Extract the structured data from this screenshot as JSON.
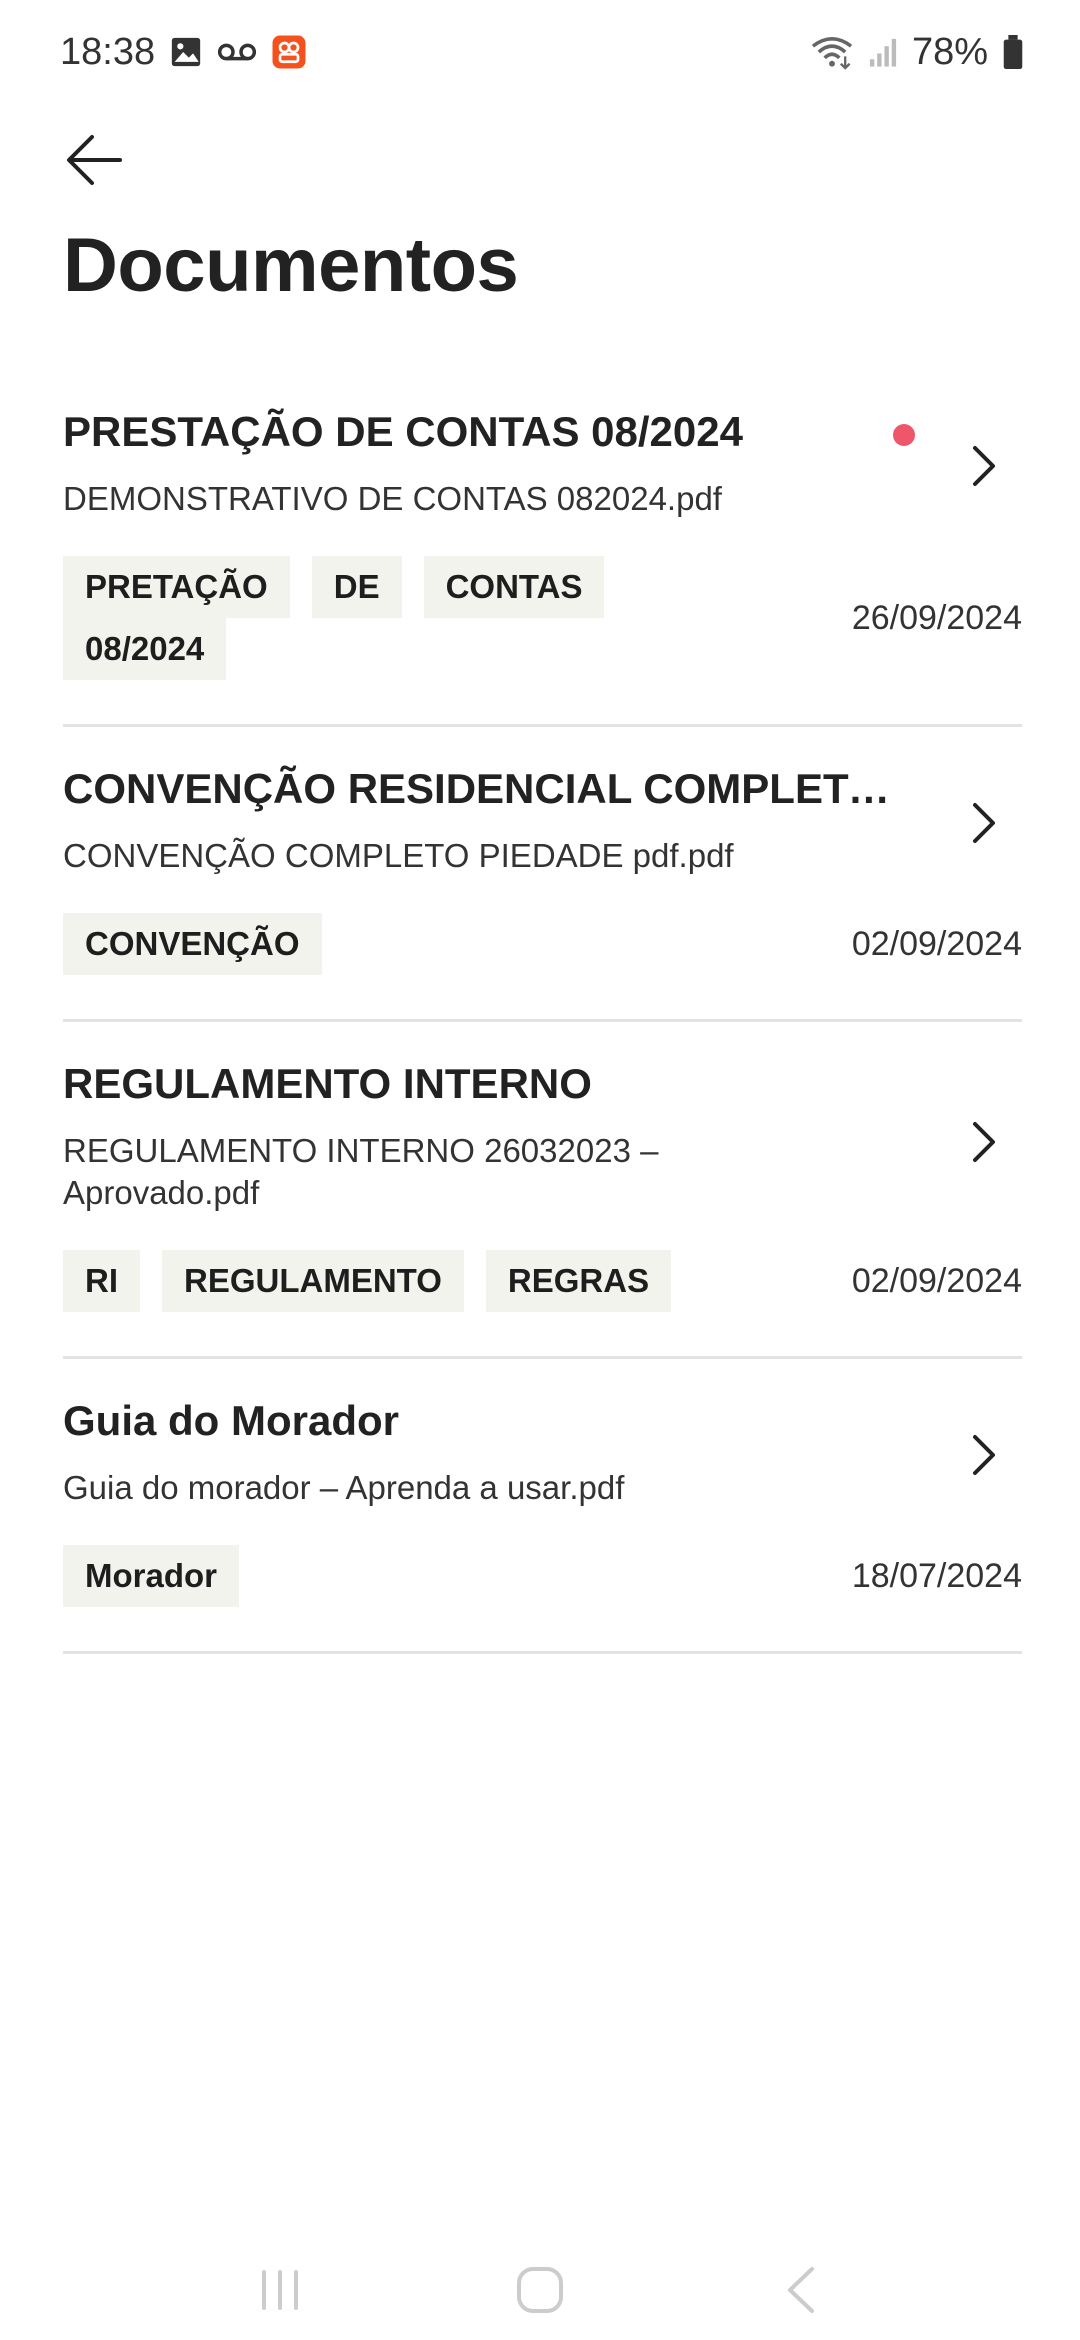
{
  "status_bar": {
    "time": "18:38",
    "battery_percent": "78%",
    "icons": [
      "image-icon",
      "voicemail-icon",
      "app-notification-icon",
      "wifi-icon",
      "signal-icon",
      "battery-icon"
    ],
    "app_icon_color": "#f4511e"
  },
  "header": {
    "title": "Documentos"
  },
  "accent": {
    "unread_dot": "#f0566a"
  },
  "documents": [
    {
      "title": "PRESTAÇÃO DE CONTAS 08/2024",
      "file": "DEMONSTRATIVO DE CONTAS 082024.pdf",
      "tags": [
        "PRETAÇÃO",
        "DE",
        "CONTAS",
        "08/2024"
      ],
      "date": "26/09/2024",
      "unread": true
    },
    {
      "title": "CONVENÇÃO RESIDENCIAL COMPLETO PIEDADE",
      "file": "CONVENÇÃO COMPLETO PIEDADE pdf.pdf",
      "tags": [
        "CONVENÇÃO"
      ],
      "date": "02/09/2024",
      "unread": false
    },
    {
      "title": "REGULAMENTO INTERNO",
      "file": "REGULAMENTO INTERNO 26032023 – Aprovado.pdf",
      "tags": [
        "RI",
        "REGULAMENTO",
        "REGRAS"
      ],
      "date": "02/09/2024",
      "unread": false
    },
    {
      "title": "Guia do Morador",
      "file": "Guia do morador – Aprenda a usar.pdf",
      "tags": [
        "Morador"
      ],
      "date": "18/07/2024",
      "unread": false
    }
  ]
}
